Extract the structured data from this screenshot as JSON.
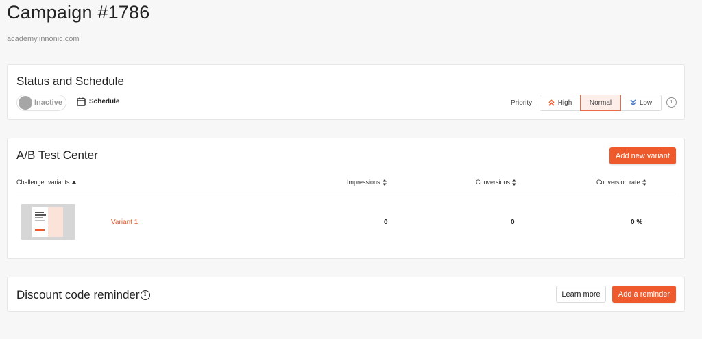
{
  "header": {
    "title": "Campaign #1786",
    "domain": "academy.innonic.com"
  },
  "status": {
    "title": "Status and Schedule",
    "toggle_label": "Inactive",
    "schedule_label": "Schedule",
    "priority_label": "Priority:",
    "priority_options": [
      "High",
      "Normal",
      "Low"
    ],
    "priority_selected": "Normal",
    "info_glyph": "i"
  },
  "ab_test": {
    "title": "A/B Test Center",
    "add_button": "Add new variant",
    "columns": [
      "Challenger variants",
      "Impressions",
      "Conversions",
      "Conversion rate"
    ],
    "rows": [
      {
        "name": "Variant 1",
        "impressions": "0",
        "conversions": "0",
        "conversion_rate": "0 %"
      }
    ]
  },
  "discount": {
    "title": "Discount code reminder",
    "info_glyph": "i",
    "learn_more": "Learn more",
    "add_button": "Add a reminder"
  },
  "colors": {
    "accent": "#ee5a2c",
    "link": "#e4582a",
    "selected_bg": "#fdeee9"
  }
}
